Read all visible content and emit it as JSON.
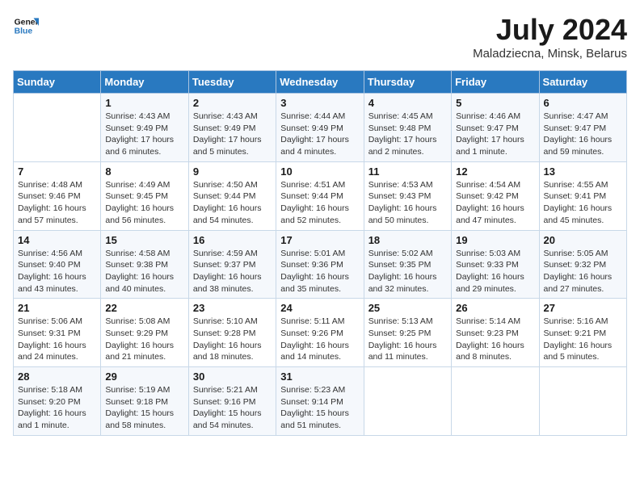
{
  "header": {
    "logo_line1": "General",
    "logo_line2": "Blue",
    "month_year": "July 2024",
    "location": "Maladziecna, Minsk, Belarus"
  },
  "weekdays": [
    "Sunday",
    "Monday",
    "Tuesday",
    "Wednesday",
    "Thursday",
    "Friday",
    "Saturday"
  ],
  "weeks": [
    [
      {
        "day": "",
        "sunrise": "",
        "sunset": "",
        "daylight": ""
      },
      {
        "day": "1",
        "sunrise": "4:43 AM",
        "sunset": "9:49 PM",
        "daylight": "17 hours and 6 minutes."
      },
      {
        "day": "2",
        "sunrise": "4:43 AM",
        "sunset": "9:49 PM",
        "daylight": "17 hours and 5 minutes."
      },
      {
        "day": "3",
        "sunrise": "4:44 AM",
        "sunset": "9:49 PM",
        "daylight": "17 hours and 4 minutes."
      },
      {
        "day": "4",
        "sunrise": "4:45 AM",
        "sunset": "9:48 PM",
        "daylight": "17 hours and 2 minutes."
      },
      {
        "day": "5",
        "sunrise": "4:46 AM",
        "sunset": "9:47 PM",
        "daylight": "17 hours and 1 minute."
      },
      {
        "day": "6",
        "sunrise": "4:47 AM",
        "sunset": "9:47 PM",
        "daylight": "16 hours and 59 minutes."
      }
    ],
    [
      {
        "day": "7",
        "sunrise": "4:48 AM",
        "sunset": "9:46 PM",
        "daylight": "16 hours and 57 minutes."
      },
      {
        "day": "8",
        "sunrise": "4:49 AM",
        "sunset": "9:45 PM",
        "daylight": "16 hours and 56 minutes."
      },
      {
        "day": "9",
        "sunrise": "4:50 AM",
        "sunset": "9:44 PM",
        "daylight": "16 hours and 54 minutes."
      },
      {
        "day": "10",
        "sunrise": "4:51 AM",
        "sunset": "9:44 PM",
        "daylight": "16 hours and 52 minutes."
      },
      {
        "day": "11",
        "sunrise": "4:53 AM",
        "sunset": "9:43 PM",
        "daylight": "16 hours and 50 minutes."
      },
      {
        "day": "12",
        "sunrise": "4:54 AM",
        "sunset": "9:42 PM",
        "daylight": "16 hours and 47 minutes."
      },
      {
        "day": "13",
        "sunrise": "4:55 AM",
        "sunset": "9:41 PM",
        "daylight": "16 hours and 45 minutes."
      }
    ],
    [
      {
        "day": "14",
        "sunrise": "4:56 AM",
        "sunset": "9:40 PM",
        "daylight": "16 hours and 43 minutes."
      },
      {
        "day": "15",
        "sunrise": "4:58 AM",
        "sunset": "9:38 PM",
        "daylight": "16 hours and 40 minutes."
      },
      {
        "day": "16",
        "sunrise": "4:59 AM",
        "sunset": "9:37 PM",
        "daylight": "16 hours and 38 minutes."
      },
      {
        "day": "17",
        "sunrise": "5:01 AM",
        "sunset": "9:36 PM",
        "daylight": "16 hours and 35 minutes."
      },
      {
        "day": "18",
        "sunrise": "5:02 AM",
        "sunset": "9:35 PM",
        "daylight": "16 hours and 32 minutes."
      },
      {
        "day": "19",
        "sunrise": "5:03 AM",
        "sunset": "9:33 PM",
        "daylight": "16 hours and 29 minutes."
      },
      {
        "day": "20",
        "sunrise": "5:05 AM",
        "sunset": "9:32 PM",
        "daylight": "16 hours and 27 minutes."
      }
    ],
    [
      {
        "day": "21",
        "sunrise": "5:06 AM",
        "sunset": "9:31 PM",
        "daylight": "16 hours and 24 minutes."
      },
      {
        "day": "22",
        "sunrise": "5:08 AM",
        "sunset": "9:29 PM",
        "daylight": "16 hours and 21 minutes."
      },
      {
        "day": "23",
        "sunrise": "5:10 AM",
        "sunset": "9:28 PM",
        "daylight": "16 hours and 18 minutes."
      },
      {
        "day": "24",
        "sunrise": "5:11 AM",
        "sunset": "9:26 PM",
        "daylight": "16 hours and 14 minutes."
      },
      {
        "day": "25",
        "sunrise": "5:13 AM",
        "sunset": "9:25 PM",
        "daylight": "16 hours and 11 minutes."
      },
      {
        "day": "26",
        "sunrise": "5:14 AM",
        "sunset": "9:23 PM",
        "daylight": "16 hours and 8 minutes."
      },
      {
        "day": "27",
        "sunrise": "5:16 AM",
        "sunset": "9:21 PM",
        "daylight": "16 hours and 5 minutes."
      }
    ],
    [
      {
        "day": "28",
        "sunrise": "5:18 AM",
        "sunset": "9:20 PM",
        "daylight": "16 hours and 1 minute."
      },
      {
        "day": "29",
        "sunrise": "5:19 AM",
        "sunset": "9:18 PM",
        "daylight": "15 hours and 58 minutes."
      },
      {
        "day": "30",
        "sunrise": "5:21 AM",
        "sunset": "9:16 PM",
        "daylight": "15 hours and 54 minutes."
      },
      {
        "day": "31",
        "sunrise": "5:23 AM",
        "sunset": "9:14 PM",
        "daylight": "15 hours and 51 minutes."
      },
      {
        "day": "",
        "sunrise": "",
        "sunset": "",
        "daylight": ""
      },
      {
        "day": "",
        "sunrise": "",
        "sunset": "",
        "daylight": ""
      },
      {
        "day": "",
        "sunrise": "",
        "sunset": "",
        "daylight": ""
      }
    ]
  ]
}
